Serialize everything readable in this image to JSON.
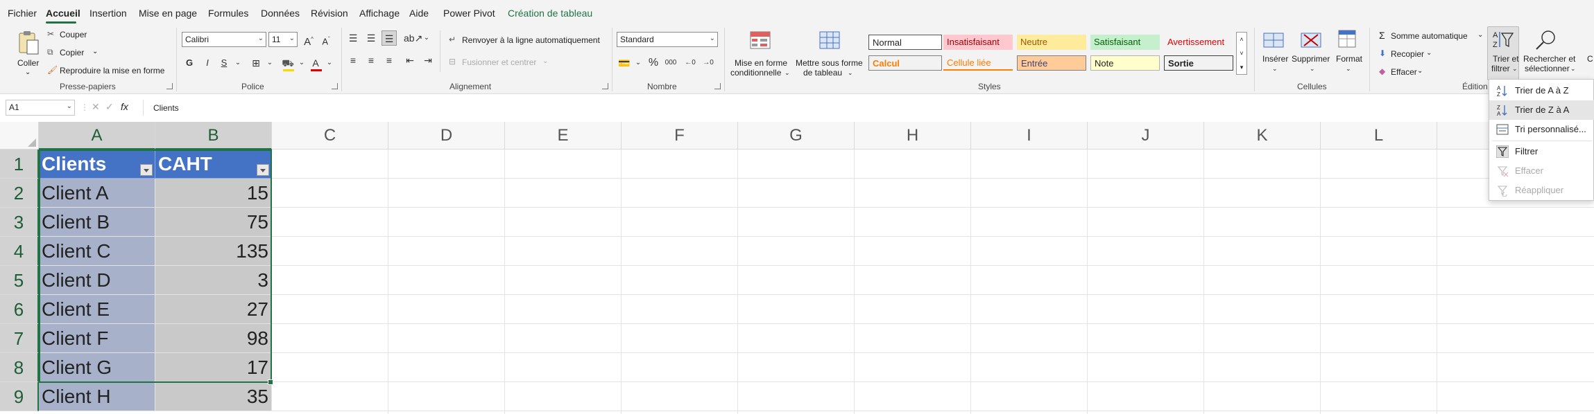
{
  "menu": {
    "items": [
      "Fichier",
      "Accueil",
      "Insertion",
      "Mise en page",
      "Formules",
      "Données",
      "Révision",
      "Affichage",
      "Aide",
      "Power Pivot",
      "Création de tableau"
    ],
    "active": "Accueil"
  },
  "ribbon": {
    "clipboard": {
      "paste": "Coller",
      "cut": "Couper",
      "copy": "Copier",
      "format_painter": "Reproduire la mise en forme",
      "label": "Presse-papiers"
    },
    "font": {
      "name": "Calibri",
      "size": "11",
      "label": "Police",
      "bold": "G",
      "italic": "I",
      "underline": "S"
    },
    "alignment": {
      "wrap": "Renvoyer à la ligne automatiquement",
      "merge": "Fusionner et centrer",
      "label": "Alignement"
    },
    "number": {
      "format": "Standard",
      "label": "Nombre",
      "percent": "%",
      "thousands": "000"
    },
    "styles": {
      "cond_format": [
        "Mise en forme",
        "conditionnelle"
      ],
      "table_format": [
        "Mettre sous forme",
        "de tableau"
      ],
      "cells": [
        "Normal",
        "Insatisfaisant",
        "Neutre",
        "Satisfaisant",
        "Avertissement",
        "Calcul",
        "Cellule liée",
        "Entrée",
        "Note",
        "Sortie"
      ],
      "label": "Styles"
    },
    "cells": {
      "insert": "Insérer",
      "delete": "Supprimer",
      "format": "Format",
      "label": "Cellules"
    },
    "editing": {
      "autosum": "Somme automatique",
      "fill": "Recopier",
      "clear": "Effacer",
      "sort_filter": [
        "Trier et",
        "filtrer"
      ],
      "find": [
        "Rechercher et",
        "sélectionner"
      ],
      "label": "Édition",
      "overflow": "C"
    }
  },
  "formula_bar": {
    "name_box": "A1",
    "fx": "fx",
    "content": "Clients"
  },
  "grid": {
    "columns": [
      "A",
      "B",
      "C",
      "D",
      "E",
      "F",
      "G",
      "H",
      "I",
      "J",
      "K",
      "L"
    ],
    "rows": [
      "1",
      "2",
      "3",
      "4",
      "5",
      "6",
      "7",
      "8",
      "9"
    ],
    "table": {
      "headers": [
        "Clients",
        "CAHT"
      ],
      "rows": [
        [
          "Client A",
          "15"
        ],
        [
          "Client B",
          "75"
        ],
        [
          "Client C",
          "135"
        ],
        [
          "Client D",
          "3"
        ],
        [
          "Client E",
          "27"
        ],
        [
          "Client F",
          "98"
        ],
        [
          "Client G",
          "17"
        ],
        [
          "Client H",
          "35"
        ]
      ]
    }
  },
  "sort_menu": {
    "items": [
      "Trier de A à Z",
      "Trier de Z à A",
      "Tri personnalisé...",
      "Filtrer",
      "Effacer",
      "Réappliquer"
    ]
  },
  "colors": {
    "accent": "#217346",
    "table_header": "#4472c4"
  }
}
